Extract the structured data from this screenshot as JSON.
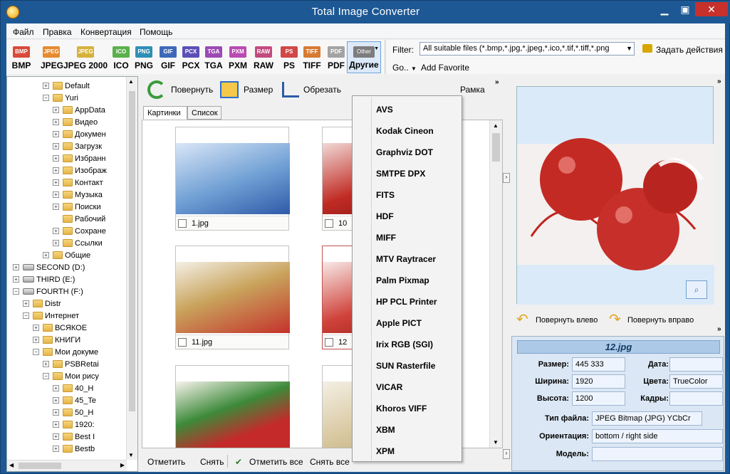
{
  "window": {
    "title": "Total Image Converter"
  },
  "menu": [
    "Файл",
    "Правка",
    "Конвертация",
    "Помощь"
  ],
  "formats": [
    {
      "label": "BMP",
      "icon": "BMP",
      "color": "#d94a3a"
    },
    {
      "label": "JPEG",
      "icon": "JPEG",
      "color": "#e58a2f"
    },
    {
      "label": "JPEG 2000",
      "icon": "JPEG 2000",
      "color": "#d6b13a"
    },
    {
      "label": "ICO",
      "icon": "ICO",
      "color": "#5bb04b"
    },
    {
      "label": "PNG",
      "icon": "PNG",
      "color": "#2f8fb5"
    },
    {
      "label": "GIF",
      "icon": "GIF",
      "color": "#3e68b8"
    },
    {
      "label": "PCX",
      "icon": "PCX",
      "color": "#5b4fb6"
    },
    {
      "label": "TGA",
      "icon": "TGA",
      "color": "#9b4ab6"
    },
    {
      "label": "PXM",
      "icon": "PXM",
      "color": "#b94ab2"
    },
    {
      "label": "RAW",
      "icon": "RAW",
      "color": "#c24b7e"
    },
    {
      "label": "PS",
      "icon": "PS",
      "color": "#d24747"
    },
    {
      "label": "TIFF",
      "icon": "TIFF",
      "color": "#d77a35"
    },
    {
      "label": "PDF",
      "icon": "PDF",
      "color": "#a3a3a3"
    }
  ],
  "other": {
    "icon": "Other",
    "label": "Другие"
  },
  "filter": {
    "label": "Filter:",
    "value": "All suitable files (*.bmp,*.jpg,*.jpeg,*.ico,*.tif,*.tiff,*.png",
    "task": "Задать действия",
    "go": "Go..",
    "add_favorite": "Add Favorite"
  },
  "tree": [
    {
      "label": "Default",
      "indent": 5,
      "type": "folder",
      "exp": "+"
    },
    {
      "label": "Yuri",
      "indent": 5,
      "type": "folder",
      "exp": "−"
    },
    {
      "label": "AppData",
      "indent": 6,
      "type": "folder",
      "exp": "+"
    },
    {
      "label": "Видео",
      "indent": 6,
      "type": "folder",
      "exp": "+"
    },
    {
      "label": "Докумен",
      "indent": 6,
      "type": "folder",
      "exp": "+"
    },
    {
      "label": "Загрузк",
      "indent": 6,
      "type": "folder",
      "exp": "+"
    },
    {
      "label": "Избранн",
      "indent": 6,
      "type": "folder",
      "exp": "+"
    },
    {
      "label": "Изображ",
      "indent": 6,
      "type": "folder",
      "exp": "+"
    },
    {
      "label": "Контакт",
      "indent": 6,
      "type": "folder",
      "exp": "+"
    },
    {
      "label": "Музыка",
      "indent": 6,
      "type": "folder",
      "exp": "+"
    },
    {
      "label": "Поиски",
      "indent": 6,
      "type": "folder",
      "exp": "+"
    },
    {
      "label": "Рабочий",
      "indent": 6,
      "type": "folder",
      "exp": ""
    },
    {
      "label": "Сохране",
      "indent": 6,
      "type": "folder",
      "exp": "+"
    },
    {
      "label": "Ссылки",
      "indent": 6,
      "type": "folder",
      "exp": "+"
    },
    {
      "label": "Общие",
      "indent": 5,
      "type": "folder",
      "exp": "+"
    },
    {
      "label": "SECOND (D:)",
      "indent": 2,
      "type": "drive",
      "exp": "+"
    },
    {
      "label": "THIRD (E:)",
      "indent": 2,
      "type": "drive",
      "exp": "+"
    },
    {
      "label": "FOURTH (F:)",
      "indent": 2,
      "type": "drive",
      "exp": "−"
    },
    {
      "label": "Distr",
      "indent": 3,
      "type": "folder",
      "exp": "+"
    },
    {
      "label": "Интернет",
      "indent": 3,
      "type": "folder",
      "exp": "−"
    },
    {
      "label": "ВСЯКОЕ",
      "indent": 4,
      "type": "folder",
      "exp": "+"
    },
    {
      "label": "КНИГИ",
      "indent": 4,
      "type": "folder",
      "exp": "+"
    },
    {
      "label": "Мои докуме",
      "indent": 4,
      "type": "folder",
      "exp": "−"
    },
    {
      "label": "PSBRetai",
      "indent": 5,
      "type": "folder",
      "exp": "+"
    },
    {
      "label": "Мои рису",
      "indent": 5,
      "type": "folder",
      "exp": "−"
    },
    {
      "label": "40_H",
      "indent": 6,
      "type": "folder",
      "exp": "+"
    },
    {
      "label": "45_Te",
      "indent": 6,
      "type": "folder",
      "exp": "+"
    },
    {
      "label": "50_H",
      "indent": 6,
      "type": "folder",
      "exp": "+"
    },
    {
      "label": "1920:",
      "indent": 6,
      "type": "folder",
      "exp": "+"
    },
    {
      "label": "Best I",
      "indent": 6,
      "type": "folder",
      "exp": "+"
    },
    {
      "label": "Bestb",
      "indent": 6,
      "type": "folder",
      "exp": "+"
    }
  ],
  "actions": {
    "rotate": "Повернуть",
    "resize": "Размер",
    "crop": "Обрезать",
    "frame": "Рамка"
  },
  "tabs": [
    "Картинки",
    "Список"
  ],
  "thumbs": [
    {
      "caption": "1.jpg"
    },
    {
      "caption": "10"
    },
    {
      "caption": "11.jpg"
    },
    {
      "caption": "12"
    },
    {
      "caption": ""
    },
    {
      "caption": ""
    }
  ],
  "bottom": {
    "mark": "Отметить",
    "unmark": "Снять",
    "mark_all": "Отметить все",
    "unmark_all": "Снять все"
  },
  "dropdown": [
    "AVS",
    "Kodak Cineon",
    "Graphviz DOT",
    "SMTPE DPX",
    "FITS",
    "HDF",
    "MIFF",
    "MTV Raytracer",
    "Palm Pixmap",
    "HP PCL Printer",
    "Apple PICT",
    "Irix RGB (SGI)",
    "SUN Rasterfile",
    "VICAR",
    "Khoros VIFF",
    "XBM",
    "XPM"
  ],
  "rotate": {
    "left": "Повернуть влево",
    "right": "Повернуть вправо"
  },
  "props": {
    "filename": "12.jpg",
    "size_label": "Размер:",
    "size": "445 333",
    "date_label": "Дата:",
    "date": "",
    "width_label": "Ширина:",
    "width": "1920",
    "colors_label": "Цвета:",
    "colors": "TrueColor",
    "height_label": "Высота:",
    "height": "1200",
    "frames_label": "Кадры:",
    "frames": "",
    "type_label": "Тип файла:",
    "type": "JPEG Bitmap (JPG) YCbCr",
    "orient_label": "Ориентация:",
    "orient": "bottom / right side",
    "model_label": "Модель:",
    "model": ""
  }
}
